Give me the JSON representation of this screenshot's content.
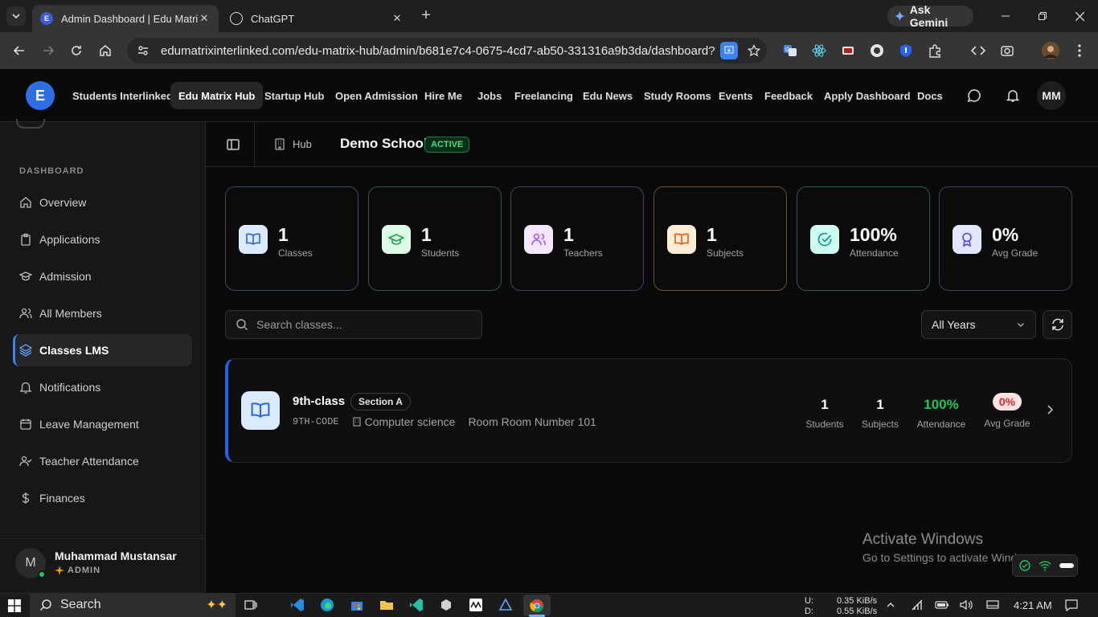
{
  "browser": {
    "tabs": [
      {
        "title": "Admin Dashboard | Edu Matrix",
        "active": true
      },
      {
        "title": "ChatGPT",
        "active": false
      }
    ],
    "ask_gemini": "Ask Gemini",
    "url": "edumatrixinterlinked.com/edu-matrix-hub/admin/b681e7c4-0675-4cd7-ab50-331316a9b3da/dashboard?tab..."
  },
  "site_nav": {
    "logo": "E",
    "items": [
      "Students Interlinked",
      "Edu Matrix Hub",
      "Startup Hub",
      "Open Admission",
      "Hire Me",
      "Jobs",
      "Freelancing",
      "Edu News",
      "Study Rooms",
      "Events",
      "Feedback",
      "Apply Dashboard",
      "Docs"
    ],
    "active": "Edu Matrix Hub",
    "avatar": "MM"
  },
  "sidebar": {
    "section_label": "DASHBOARD",
    "items": [
      {
        "label": "Overview",
        "icon": "home-icon"
      },
      {
        "label": "Applications",
        "icon": "clipboard-icon"
      },
      {
        "label": "Admission",
        "icon": "graduation-cap-icon"
      },
      {
        "label": "All Members",
        "icon": "users-icon"
      },
      {
        "label": "Classes LMS",
        "icon": "layers-icon",
        "active": true
      },
      {
        "label": "Notifications",
        "icon": "bell-icon"
      },
      {
        "label": "Leave Management",
        "icon": "calendar-icon"
      },
      {
        "label": "Teacher Attendance",
        "icon": "user-check-icon"
      },
      {
        "label": "Finances",
        "icon": "dollar-icon"
      }
    ],
    "user": {
      "initial": "M",
      "name": "Muhammad Mustansar",
      "role": "ADMIN"
    }
  },
  "header": {
    "crumb": "Hub",
    "school": "Demo School",
    "status": "ACTIVE"
  },
  "stats": [
    {
      "value": "1",
      "label": "Classes",
      "icon": "book-open-icon",
      "color": "#3b82f6"
    },
    {
      "value": "1",
      "label": "Students",
      "icon": "graduation-cap-icon",
      "color": "#16a34a"
    },
    {
      "value": "1",
      "label": "Teachers",
      "icon": "users-icon",
      "color": "#a855f7"
    },
    {
      "value": "1",
      "label": "Subjects",
      "icon": "book-open-icon",
      "color": "#ea580c"
    },
    {
      "value": "100%",
      "label": "Attendance",
      "icon": "check-circle-icon",
      "color": "#0d9488"
    },
    {
      "value": "0%",
      "label": "Avg Grade",
      "icon": "award-icon",
      "color": "#4f46e5"
    }
  ],
  "filters": {
    "search_placeholder": "Search classes...",
    "year_select": "All Years"
  },
  "class_card": {
    "name": "9th-class",
    "section": "Section A",
    "code": "9TH-CODE",
    "department": "Computer science",
    "room": "Room Room Number 101",
    "stats": [
      {
        "value": "1",
        "label": "Students"
      },
      {
        "value": "1",
        "label": "Subjects"
      },
      {
        "value": "100%",
        "label": "Attendance"
      },
      {
        "value": "0%",
        "label": "Avg Grade"
      }
    ]
  },
  "watermark": {
    "title": "Activate Windows",
    "subtitle": "Go to Settings to activate Windows."
  },
  "taskbar": {
    "search": "Search",
    "net_up_label": "U:",
    "net_down_label": "D:",
    "net_up": "0.35 KiB/s",
    "net_down": "0.55 KiB/s",
    "time": "4:21 AM"
  }
}
